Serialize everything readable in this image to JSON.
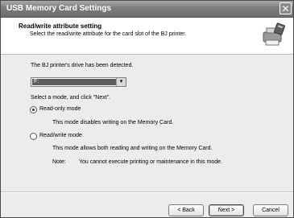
{
  "window": {
    "title": "USB Memory Card Settings"
  },
  "header": {
    "title": "Read/write attribute setting",
    "subtitle": "Select the read/write attribute for the card slot of the BJ printer.",
    "icon": "printer-card-icon"
  },
  "main": {
    "detected_text": "The BJ printer's drive has been detected.",
    "drive_select": {
      "value": "F:"
    },
    "instruction": "Select a mode, and click \"Next\".",
    "readonly": {
      "label": "Read-only mode",
      "description": "This mode disables writing on the Memory Card.",
      "selected": true
    },
    "readwrite": {
      "label": "Read/write mode",
      "description": "This mode allows both reading and writing on the Memory Card.",
      "note_label": "Note:",
      "note_text": "You cannot execute printing or maintenance in this mode.",
      "selected": false
    }
  },
  "buttons": {
    "back": "< Back",
    "next": "Next >",
    "cancel": "Cancel"
  },
  "icons": {
    "close": "close-icon",
    "dropdown": "chevron-down-icon"
  }
}
